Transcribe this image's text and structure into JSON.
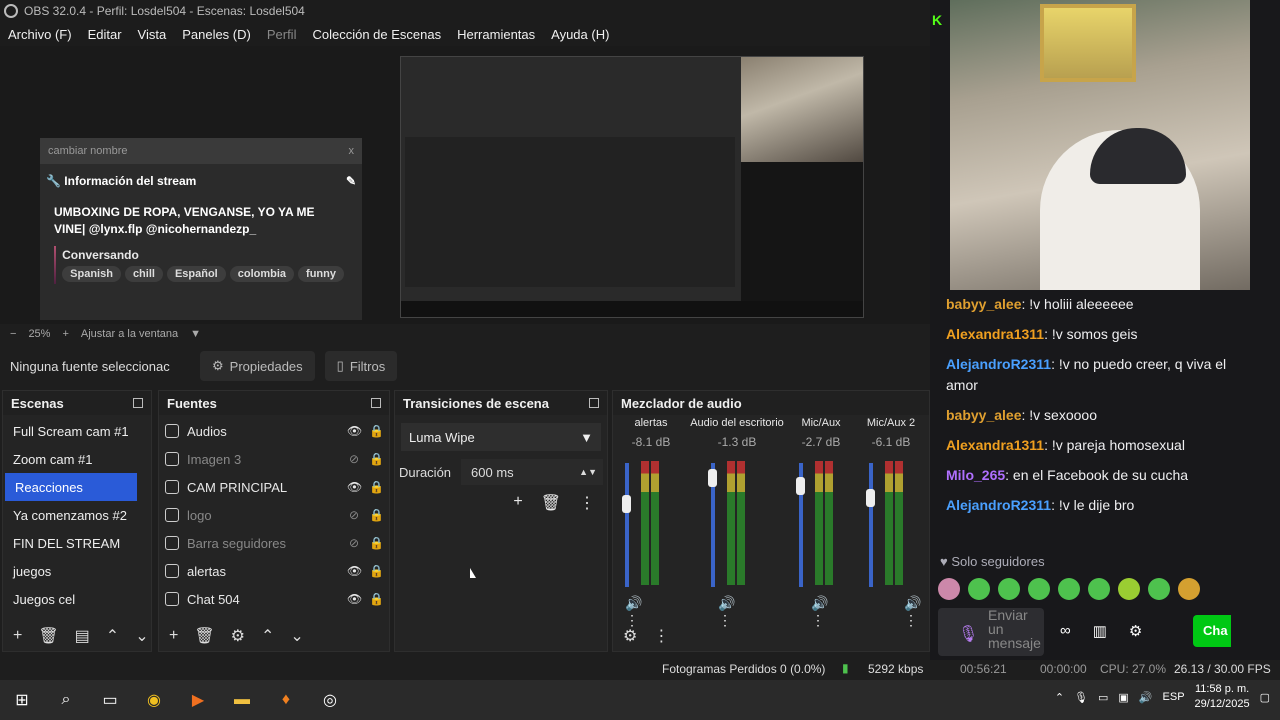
{
  "window": {
    "title": "OBS 32.0.4 - Perfil: Losdel504 - Escenas: Losdel504"
  },
  "menu": [
    "Archivo (F)",
    "Editar",
    "Vista",
    "Paneles (D)",
    "Perfil",
    "Colección de Escenas",
    "Herramientas",
    "Ayuda (H)"
  ],
  "stream_card": {
    "rename": "cambiar nombre",
    "close": "x",
    "header": "Información del stream",
    "title": "UMBOXING DE ROPA, VENGANSE, YO YA ME VINE| @lynx.flp @nicohernandezp_",
    "category": "Conversando",
    "tags": [
      "Spanish",
      "chill",
      "Español",
      "colombia",
      "funny"
    ]
  },
  "zoom": {
    "minus": "−",
    "value": "25%",
    "plus": "+",
    "fit": "Ajustar a la ventana"
  },
  "source_bar": {
    "none": "Ninguna fuente seleccionac",
    "props": "Propiedades",
    "filters": "Filtros"
  },
  "scenes": {
    "title": "Escenas",
    "items": [
      "Full Scream cam #1",
      "Zoom cam #1",
      "Reacciones",
      "Ya comenzamos #2",
      "FIN DEL STREAM",
      "juegos",
      "Juegos cel"
    ],
    "selected": 2
  },
  "sources": {
    "title": "Fuentes",
    "items": [
      {
        "name": "Audios",
        "visible": true
      },
      {
        "name": "Imagen 3",
        "visible": false
      },
      {
        "name": "CAM PRINCIPAL",
        "visible": true
      },
      {
        "name": "logo",
        "visible": false
      },
      {
        "name": "Barra seguidores",
        "visible": false
      },
      {
        "name": "alertas",
        "visible": true
      },
      {
        "name": "Chat 504",
        "visible": true
      }
    ]
  },
  "transitions": {
    "title": "Transiciones de escena",
    "selected": "Luma Wipe",
    "duration_label": "Duración",
    "duration": "600 ms"
  },
  "mixer": {
    "title": "Mezclador de audio",
    "channels": [
      {
        "name": "alertas",
        "db": "-8.1 dB"
      },
      {
        "name": "Audio del escritorio",
        "db": "-1.3 dB"
      },
      {
        "name": "Mic/Aux",
        "db": "-2.7 dB"
      },
      {
        "name": "Mic/Aux 2",
        "db": "-6.1 dB"
      }
    ],
    "scale": [
      "0",
      "-5",
      "-10",
      "-15",
      "-20",
      "-25",
      "-30",
      "-35",
      "-40",
      "-45",
      "-50",
      "-55",
      "-60"
    ]
  },
  "chat": {
    "messages": [
      {
        "user": "babyy_alee",
        "color": "#e0a030",
        "text": ": !v holiii aleeeeee"
      },
      {
        "user": "Alexandra1311",
        "color": "#f0a020",
        "text": ": !v somos geis"
      },
      {
        "user": "AlejandroR2311",
        "color": "#4aa0ff",
        "text": ": !v no puedo creer, q viva el amor"
      },
      {
        "user": "babyy_alee",
        "color": "#e0a030",
        "text": ": !v sexoooo"
      },
      {
        "user": "Alexandra1311",
        "color": "#f0a020",
        "text": ": !v pareja homosexual"
      },
      {
        "user": "Milo_265",
        "color": "#b070ff",
        "text": ": en el Facebook de su cucha"
      },
      {
        "user": "AlejandroR2311",
        "color": "#4aa0ff",
        "text": ": !v le dije bro"
      }
    ],
    "followers_only": "Solo seguidores",
    "placeholder": "Enviar un mensaje",
    "send": "Cha"
  },
  "status": {
    "frames": "Fotogramas Perdidos 0 (0.0%)",
    "kbps": "5292 kbps",
    "rec_time": "00:56:21",
    "stream_time": "00:00:00",
    "cpu": "CPU: 27.0%",
    "fps": "26.13 / 30.00 FPS"
  },
  "taskbar": {
    "time": "11:58 p. m.",
    "date": "29/12/2025",
    "lang": "ESP"
  }
}
